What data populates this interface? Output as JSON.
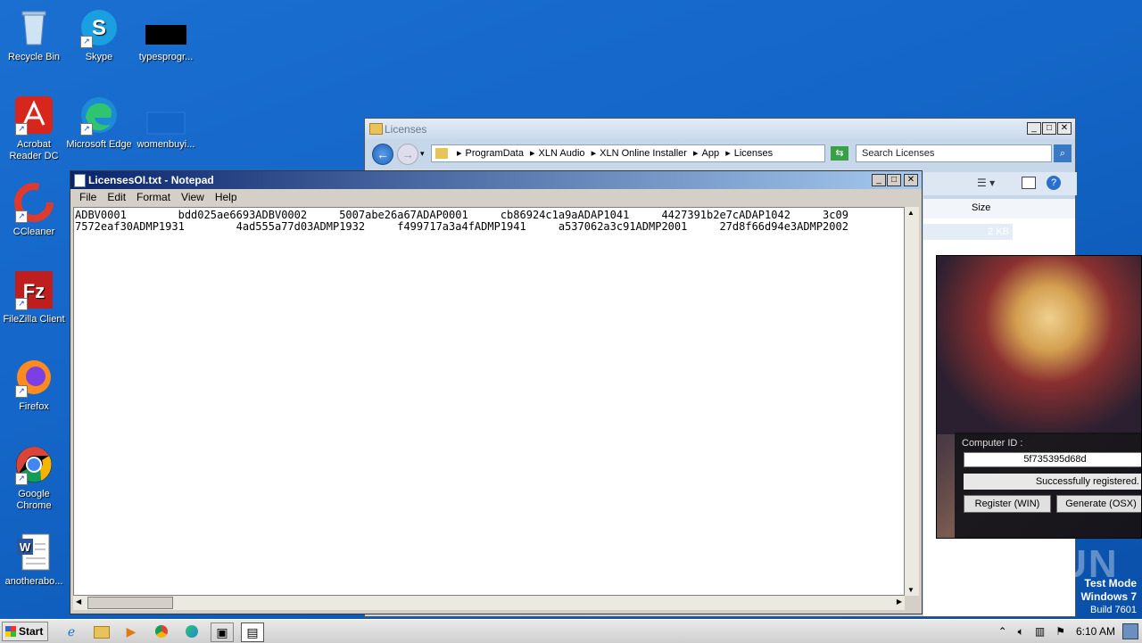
{
  "desktop": {
    "icons": [
      {
        "label": "Recycle Bin"
      },
      {
        "label": "Skype"
      },
      {
        "label": "typesprogr..."
      },
      {
        "label": "Acrobat Reader DC"
      },
      {
        "label": "Microsoft Edge"
      },
      {
        "label": "womenbuyi..."
      },
      {
        "label": "CCleaner"
      },
      {
        "label": "FileZilla Client"
      },
      {
        "label": "Firefox"
      },
      {
        "label": "Google Chrome"
      },
      {
        "label": "anotherabo..."
      }
    ]
  },
  "explorer": {
    "title": "Licenses",
    "breadcrumbs": [
      "ProgramData",
      "XLN Audio",
      "XLN Online Installer",
      "App",
      "Licenses"
    ],
    "search_placeholder": "Search Licenses",
    "columns": [
      "Size"
    ],
    "row_size": "2 KB"
  },
  "notepad": {
    "title": "LicensesOI.txt - Notepad",
    "menu": [
      "File",
      "Edit",
      "Format",
      "View",
      "Help"
    ],
    "content": "ADBV0001        bdd025ae6693ADBV0002     5007abe26a67ADAP0001     cb86924c1a9aADAP1041     4427391b2e7cADAP1042     3c09\n7572eaf30ADMP1931        4ad555a77d03ADMP1932     f499717a3a4fADMP1941     a537062a3c91ADMP2001     27d8f66d94e3ADMP2002"
  },
  "keygen": {
    "computer_id_label": "Computer ID :",
    "computer_id_value": "5f735395d68d",
    "status": "Successfully registered.",
    "register_button": "Register (WIN)",
    "generate_button": "Generate (OSX)"
  },
  "watermark": "ANY RUN",
  "test_mode": {
    "line1": "Test Mode",
    "line2": "Windows 7",
    "line3": "Build 7601"
  },
  "taskbar": {
    "start_label": "Start",
    "clock": "6:10 AM"
  }
}
